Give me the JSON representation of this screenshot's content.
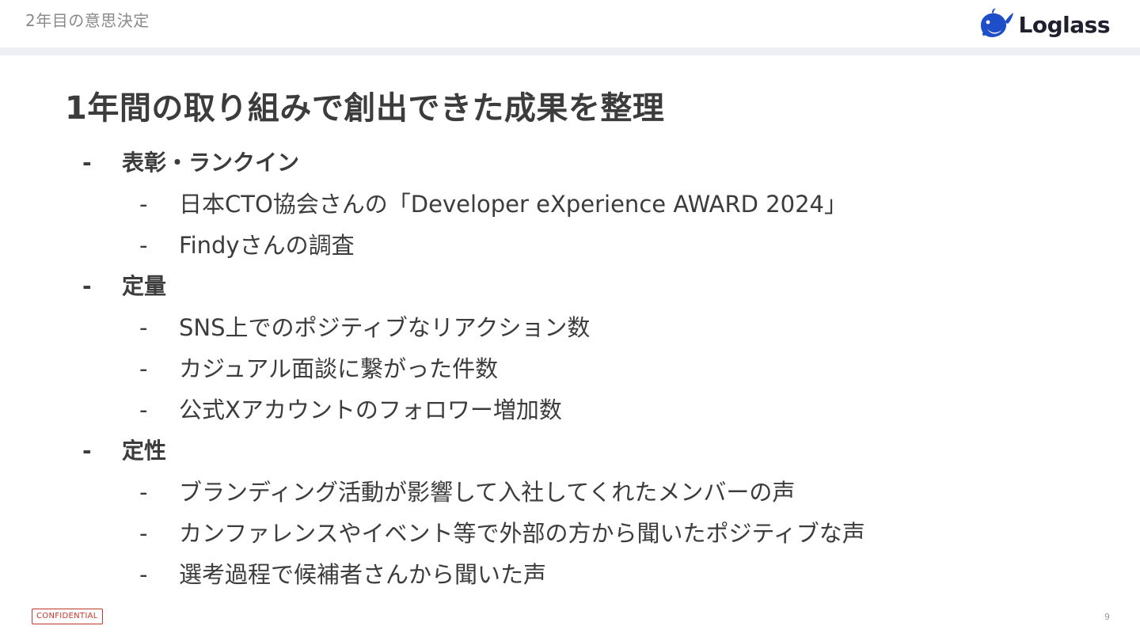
{
  "header": {
    "section_title": "2年目の意思決定",
    "logo_text": "Loglass"
  },
  "slide": {
    "title": "1年間の取り組みで創出できた成果を整理",
    "bullets": [
      {
        "label": "表彰・ランクイン",
        "items": [
          "日本CTO協会さんの「Developer eXperience AWARD 2024」",
          "Findyさんの調査"
        ]
      },
      {
        "label": "定量",
        "items": [
          "SNS上でのポジティブなリアクション数",
          "カジュアル面談に繋がった件数",
          "公式Xアカウントのフォロワー増加数"
        ]
      },
      {
        "label": "定性",
        "items": [
          "ブランディング活動が影響して入社してくれたメンバーの声",
          "カンファレンスやイベント等で外部の方から聞いたポジティブな声",
          "選考過程で候補者さんから聞いた声"
        ]
      }
    ],
    "dash": "-"
  },
  "footer": {
    "confidential": "CONFIDENTIAL",
    "page_number": "9"
  },
  "colors": {
    "brand_blue": "#1e4fc9",
    "header_bar": "#eef0f6",
    "confidential_red": "#c0392b"
  }
}
